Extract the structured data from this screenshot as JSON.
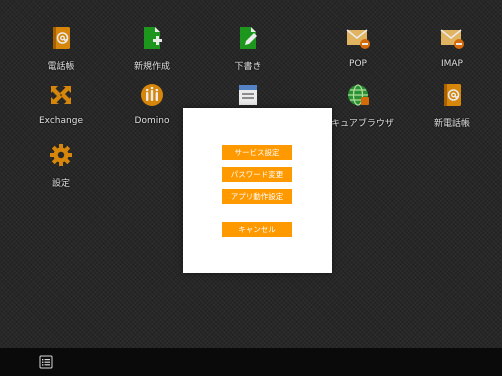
{
  "apps": [
    {
      "label": "電話帳",
      "icon": "address-book-icon"
    },
    {
      "label": "新規作成",
      "icon": "new-document-icon"
    },
    {
      "label": "下書き",
      "icon": "draft-icon"
    },
    {
      "label": "POP",
      "icon": "pop-mail-icon"
    },
    {
      "label": "IMAP",
      "icon": "imap-mail-icon"
    },
    {
      "label": "Exchange",
      "icon": "exchange-icon"
    },
    {
      "label": "Domino",
      "icon": "domino-icon"
    },
    {
      "label": "",
      "icon": "mail-box-icon"
    },
    {
      "label": "セキュアブラウザ",
      "icon": "secure-browser-icon"
    },
    {
      "label": "新電話帳",
      "icon": "new-address-book-icon"
    },
    {
      "label": "設定",
      "icon": "settings-gear-icon"
    }
  ],
  "dialog": {
    "buttons": [
      "サービス設定",
      "パスワード変更",
      "アプリ動作設定"
    ],
    "cancel": "キャンセル"
  },
  "taskbar": {
    "menu_icon": "list-menu-icon"
  },
  "colors": {
    "accent": "#ff9900",
    "background": "#2b2b2b",
    "taskbar": "#0a0a0a",
    "dialog": "#ffffff",
    "label_text": "#f2f2f2"
  }
}
